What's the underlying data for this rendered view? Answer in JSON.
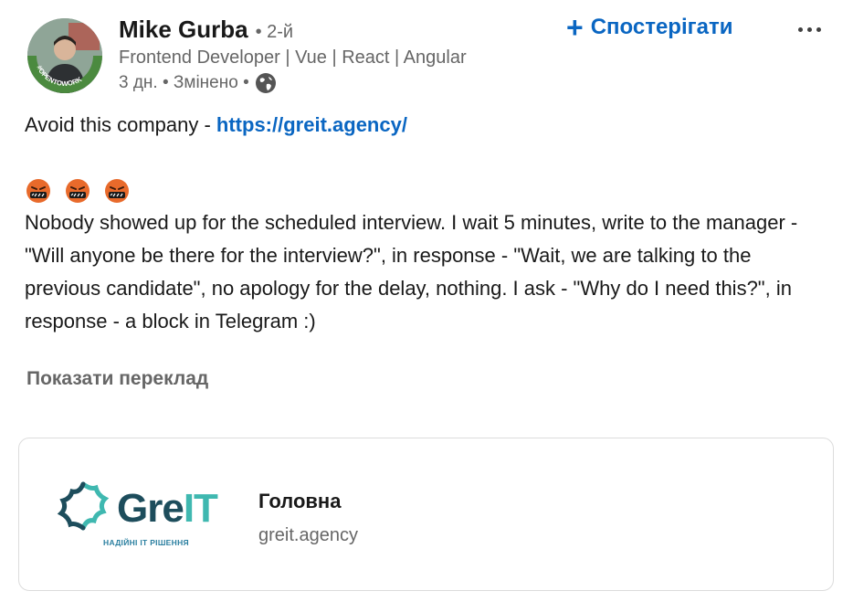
{
  "author": {
    "name": "Mike Gurba",
    "degree": "• 2-й",
    "headline": "Frontend Developer | Vue | React | Angular",
    "meta": "3 дн. • Змінено •",
    "avatar_badge": "#OPENTOWORK"
  },
  "actions": {
    "follow_label": "Спостерігати",
    "follow_icon": "plus-icon",
    "more_icon": "ellipsis-icon"
  },
  "post": {
    "intro": "Avoid this company - ",
    "link": "https://greit.agency/",
    "emoji": [
      "cursing-face",
      "cursing-face",
      "cursing-face"
    ],
    "body": "Nobody showed up for the scheduled interview. I wait 5 minutes, write to the manager - \"Will anyone be there for the interview?\", in response - \"Wait, we are talking to the previous candidate\", no apology for the delay, nothing. I ask - \"Why do I need this?\", in response - a block in Telegram :)"
  },
  "translate_label": "Показати переклад",
  "link_card": {
    "logo_text_a": "Gre",
    "logo_text_b": "IT",
    "logo_tagline": "НАДІЙНІ IT РІШЕННЯ",
    "title": "Головна",
    "domain": "greit.agency"
  },
  "colors": {
    "link": "#0a66c2",
    "muted": "#666666",
    "logo_dark": "#1d4d5c",
    "logo_teal": "#3fb8b0"
  }
}
